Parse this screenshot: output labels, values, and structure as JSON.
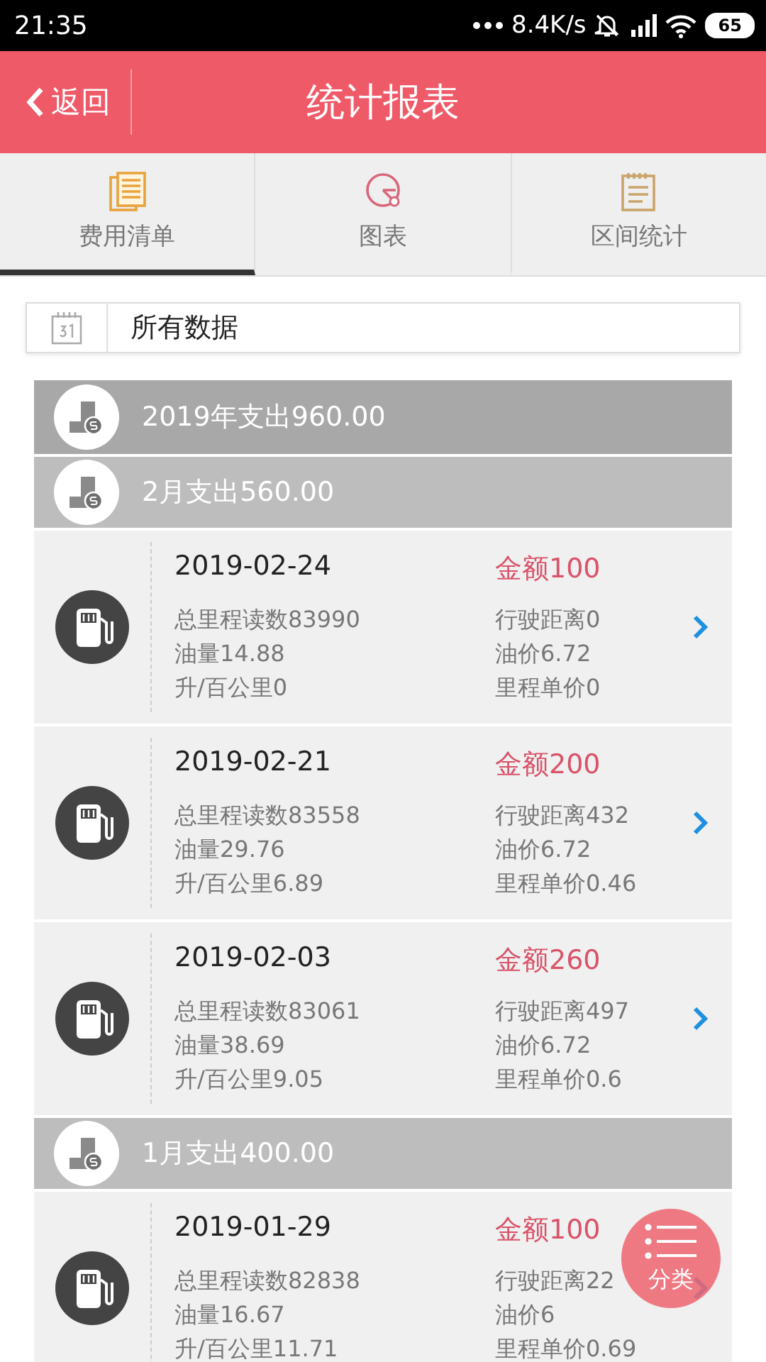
{
  "status_bar": {
    "time": "21:35",
    "speed": "8.4K/s",
    "battery": "65"
  },
  "header": {
    "back": "返回",
    "title": "统计报表"
  },
  "tabs": [
    {
      "label": "费用清单",
      "kind": "list",
      "selected": true
    },
    {
      "label": "图表",
      "kind": "chart",
      "selected": false
    },
    {
      "label": "区间统计",
      "kind": "notes",
      "selected": false
    }
  ],
  "filter": {
    "value": "所有数据"
  },
  "groups": [
    {
      "kind": "year",
      "title": "2019年支出960.00"
    },
    {
      "kind": "month",
      "title": "2月支出560.00",
      "entries": [
        {
          "date": "2019-02-24",
          "amount": "金额100",
          "odometer": "总里程读数83990",
          "fuel": "油量14.88",
          "consumption": "升/百公里0",
          "distance": "行驶距离0",
          "price": "油价6.72",
          "unit_price": "里程单价0"
        },
        {
          "date": "2019-02-21",
          "amount": "金额200",
          "odometer": "总里程读数83558",
          "fuel": "油量29.76",
          "consumption": "升/百公里6.89",
          "distance": "行驶距离432",
          "price": "油价6.72",
          "unit_price": "里程单价0.46"
        },
        {
          "date": "2019-02-03",
          "amount": "金额260",
          "odometer": "总里程读数83061",
          "fuel": "油量38.69",
          "consumption": "升/百公里9.05",
          "distance": "行驶距离497",
          "price": "油价6.72",
          "unit_price": "里程单价0.6"
        }
      ]
    },
    {
      "kind": "month",
      "title": "1月支出400.00",
      "entries": [
        {
          "date": "2019-01-29",
          "amount": "金额100",
          "odometer": "总里程读数82838",
          "fuel": "油量16.67",
          "consumption": "升/百公里11.71",
          "distance": "行驶距离22",
          "price": "油价6",
          "unit_price": "里程单价0.69"
        }
      ]
    }
  ],
  "fab": {
    "label": "分类"
  }
}
